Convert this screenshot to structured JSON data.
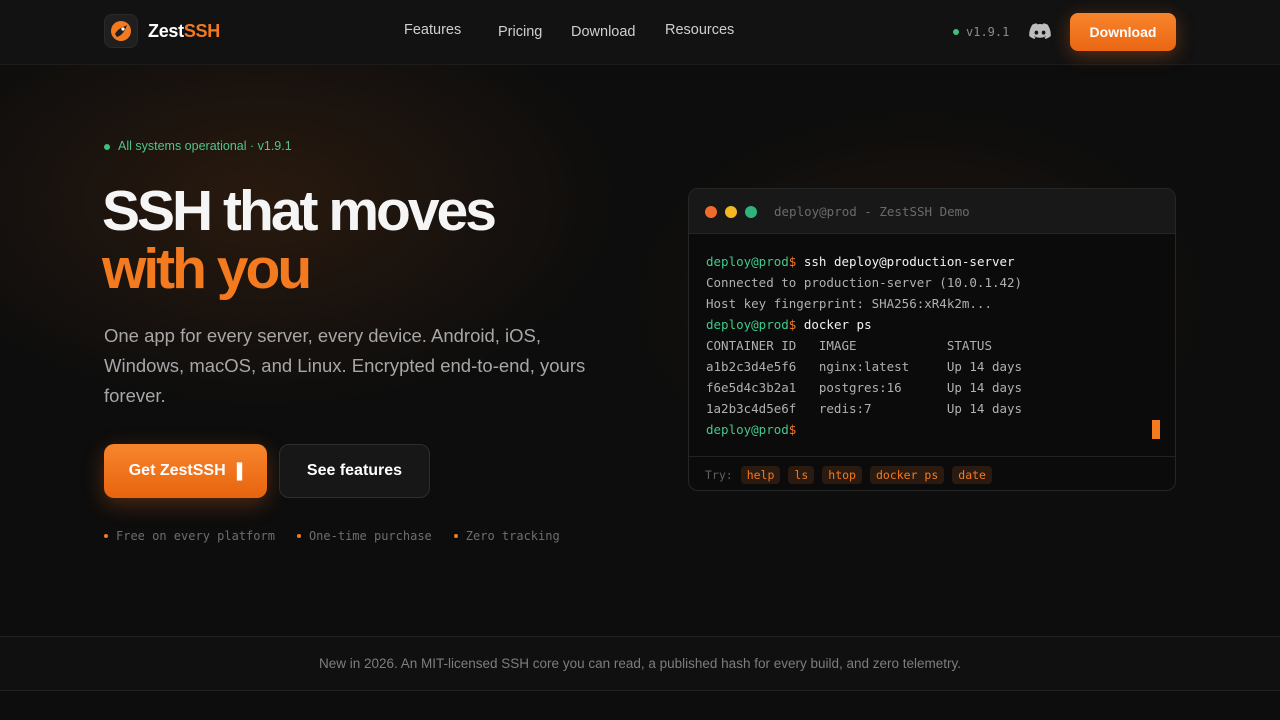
{
  "header": {
    "brand_part1": "Zest",
    "brand_part2": "SSH",
    "nav": [
      "Features",
      "Pricing",
      "Download",
      "Resources"
    ],
    "version": "v1.9.1",
    "download_label": "Download",
    "discord_icon": "discord-icon"
  },
  "hero": {
    "status": "All systems operational · v1.9.1",
    "headline_line1": "SSH that moves",
    "headline_line2": "with you",
    "subtitle": "One app for every server, every device. Android, iOS, Windows, macOS, and Linux. Encrypted end-to-end, yours forever.",
    "cta_primary": "Get ZestSSH",
    "cta_primary_icon": "▐",
    "cta_secondary": "See features",
    "perks": [
      "Free on every platform",
      "One-time purchase",
      "Zero tracking"
    ]
  },
  "terminal": {
    "title": "deploy@prod - ZestSSH Demo",
    "prompt": "deploy@prod",
    "dollar": "$",
    "lines": [
      {
        "type": "cmd",
        "text": "ssh deploy@production-server"
      },
      {
        "type": "out",
        "text": "Connected to production-server (10.0.1.42)"
      },
      {
        "type": "out",
        "text": "Host key fingerprint: SHA256:xR4k2m..."
      },
      {
        "type": "cmd",
        "text": "docker ps"
      },
      {
        "type": "out",
        "text": "CONTAINER ID   IMAGE            STATUS"
      },
      {
        "type": "out",
        "text": "a1b2c3d4e5f6   nginx:latest     Up 14 days"
      },
      {
        "type": "out",
        "text": "f6e5d4c3b2a1   postgres:16      Up 14 days"
      },
      {
        "type": "out",
        "text": "1a2b3c4d5e6f   redis:7          Up 14 days"
      },
      {
        "type": "prompt",
        "text": ""
      }
    ],
    "try_label": "Try:",
    "suggestions": [
      "help",
      "ls",
      "htop",
      "docker ps",
      "date"
    ],
    "colors": {
      "red": "#f26b2a",
      "yellow": "#f5b722",
      "green": "#2fb37a"
    }
  },
  "band": {
    "text": "New in 2026. An MIT-licensed SSH core you can read, a published hash for every build, and zero telemetry."
  },
  "colors": {
    "accent": "#f47a20",
    "ok": "#3fbf7f",
    "bg": "#0d0d0d"
  }
}
